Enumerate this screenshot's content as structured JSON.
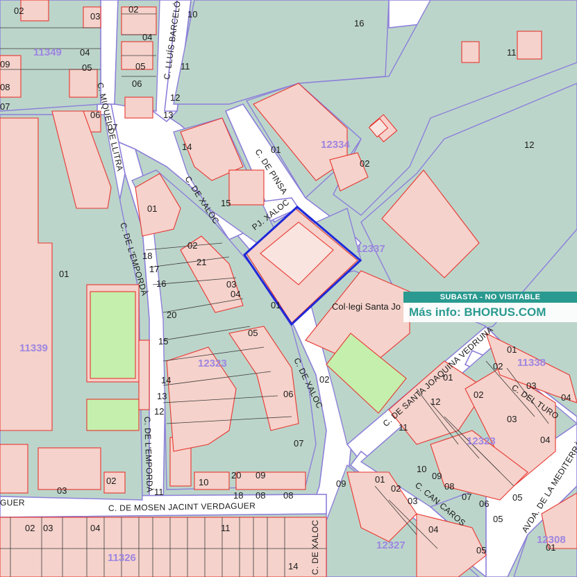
{
  "banner": {
    "status": "SUBASTA - NO VISITABLE",
    "info": "Más info: BHORUS.COM"
  },
  "colors": {
    "block": "#bcd5cb",
    "building": "#f5d2cb",
    "building_outline": "#e8352f",
    "road": "#ffffff",
    "road_outline": "#8c7fd9",
    "sports_court": "#c5efac",
    "block_label": "#9d86e0",
    "highlight_parcel": "#1e28d8",
    "banner_bg": "#2a9a90"
  },
  "streets": [
    "C. DE XALOC",
    "C. DE XALOC",
    "C. DE XALOC",
    "C. DE PINSA",
    "PJ. XALOC",
    "C. DE L'EMPORDÀ",
    "C. DE L'EMPORDÀ",
    "C. MIQUEL DE LLITRA",
    "C. LLUÍS BARCELÓ",
    "C. DE MOSEN JACINT VERDAGUER",
    "C. DE SANTA JOAQUINA VEDRUNA",
    "C. DEL TURO",
    "C. CAN CAROS",
    "AVDA. DE LA MEDITERRÀNIA",
    "GUER"
  ],
  "blocks": [
    "11349",
    "12334",
    "12337",
    "11339",
    "12323",
    "11338",
    "12323",
    "12327",
    "11326",
    "12308"
  ],
  "parcels": [
    "01",
    "02",
    "03",
    "04",
    "05",
    "06",
    "07",
    "08",
    "09",
    "10",
    "11",
    "12",
    "13",
    "14",
    "15",
    "16",
    "17",
    "18",
    "20",
    "21"
  ],
  "places": [
    "Col·legi Santa Jo"
  ]
}
